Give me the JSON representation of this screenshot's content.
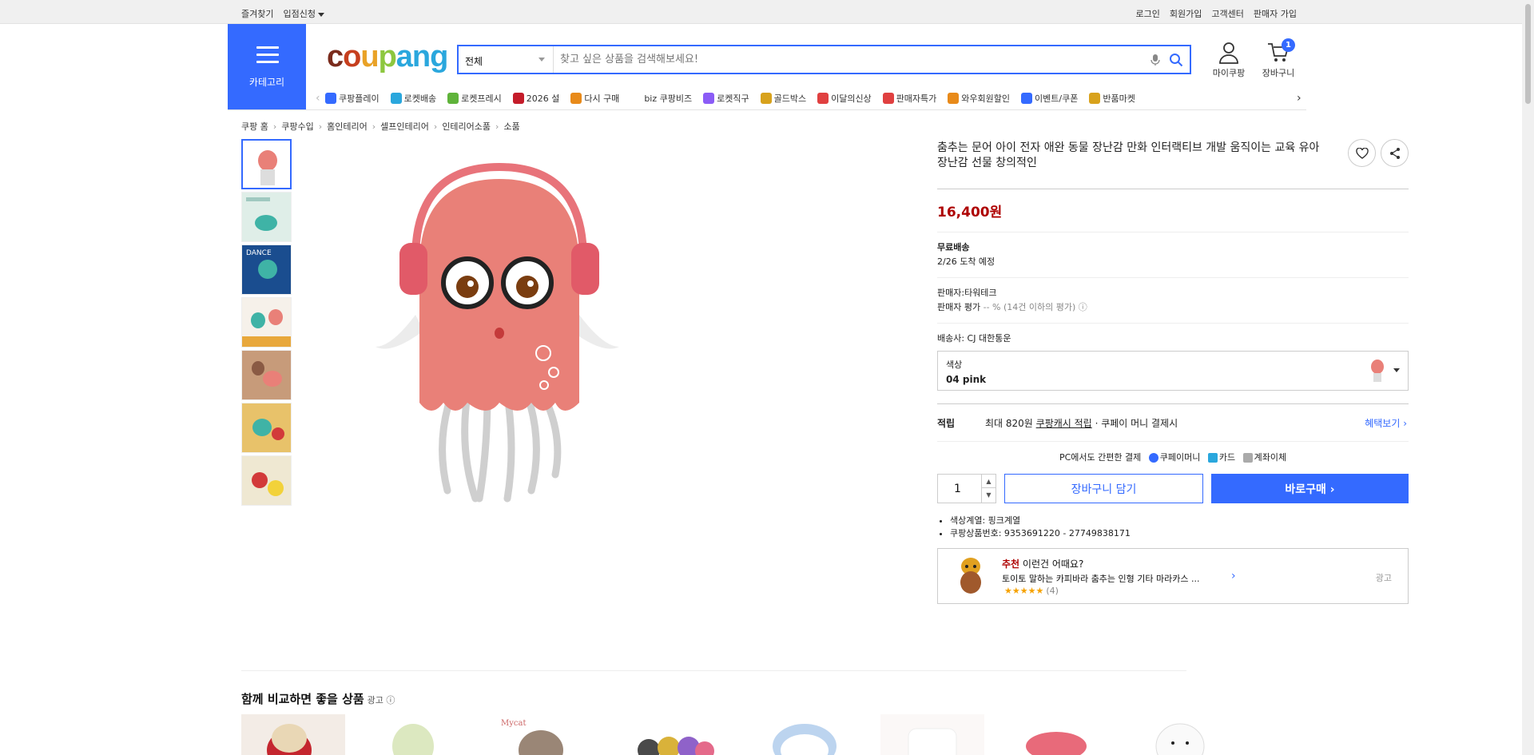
{
  "topbar": {
    "left": [
      "즐겨찾기",
      "입점신청"
    ],
    "right": [
      "로그인",
      "회원가입",
      "고객센터",
      "판매자 가입"
    ]
  },
  "header": {
    "category_label": "카테고리",
    "search": {
      "scope": "전체",
      "placeholder": "찾고 싶은 상품을 검색해보세요!"
    },
    "mycoupang_label": "마이쿠팡",
    "cart_label": "장바구니",
    "cart_count": "1"
  },
  "menus": [
    {
      "label": "쿠팡플레이",
      "color": "#346aff"
    },
    {
      "label": "로켓배송",
      "color": "#2aa7dd"
    },
    {
      "label": "로켓프레시",
      "color": "#5fb33a"
    },
    {
      "label": "2026 설",
      "color": "#c41c2a"
    },
    {
      "label": "다시 구매",
      "color": "#e88a1a"
    },
    {
      "label": "biz 쿠팡비즈",
      "color": "#ffffff"
    },
    {
      "label": "로켓직구",
      "color": "#8b5cf6"
    },
    {
      "label": "골드박스",
      "color": "#d8a21c"
    },
    {
      "label": "이달의신상",
      "color": "#e04040"
    },
    {
      "label": "판매자특가",
      "color": "#e04040"
    },
    {
      "label": "와우회원할인",
      "color": "#e88a1a"
    },
    {
      "label": "이벤트/쿠폰",
      "color": "#346aff"
    },
    {
      "label": "반품마켓",
      "color": "#d8a21c"
    }
  ],
  "breadcrumb": [
    "쿠팡 홈",
    "쿠팡수입",
    "홈인테리어",
    "셀프인테리어",
    "인테리어소품",
    "소품"
  ],
  "product": {
    "title": "춤추는 문어 아이 전자 애완 동물 장난감 만화 인터랙티브 개발 움직이는 교육 유아 장난감 선물 창의적인",
    "price": "16,400원",
    "shipping_title": "무료배송",
    "arrival": "2/26 도착 예정",
    "seller": "판매자:타워테크",
    "seller_rating": "판매자 평가",
    "seller_rating_value": "-- % (14건 이하의 평가)",
    "courier": "배송사:  CJ 대한통운",
    "option_label": "색상",
    "option_value": "04 pink",
    "reward_title": "적립",
    "reward_text_1": "최대 820원",
    "reward_text_2": "쿠팡캐시 적립",
    "reward_text_3": "· 쿠페이 머니 결제시",
    "reward_link": "혜택보기 ›",
    "pay_text": "PC에서도 간편한 결제",
    "pay_money": "쿠페이머니",
    "pay_card": "카드",
    "pay_bank": "계좌이체",
    "quantity": "1",
    "add_cart": "장바구니 담기",
    "buy_now": "바로구매 ›",
    "specs": [
      "색상계열: 핑크계열",
      "쿠팡상품번호: 9353691220 - 27749838171"
    ]
  },
  "recommend": {
    "label_red": "추천",
    "label_rest": "이런건 어때요?",
    "desc": "토이토 말하는 카피바라 춤추는 인형 기타 마라카스 ...",
    "stars": "★★★★★",
    "count": "(4)",
    "ad": "광고"
  },
  "compare": {
    "title": "함께 비교하면 좋을 상품",
    "ad": "광고 ⓘ"
  }
}
